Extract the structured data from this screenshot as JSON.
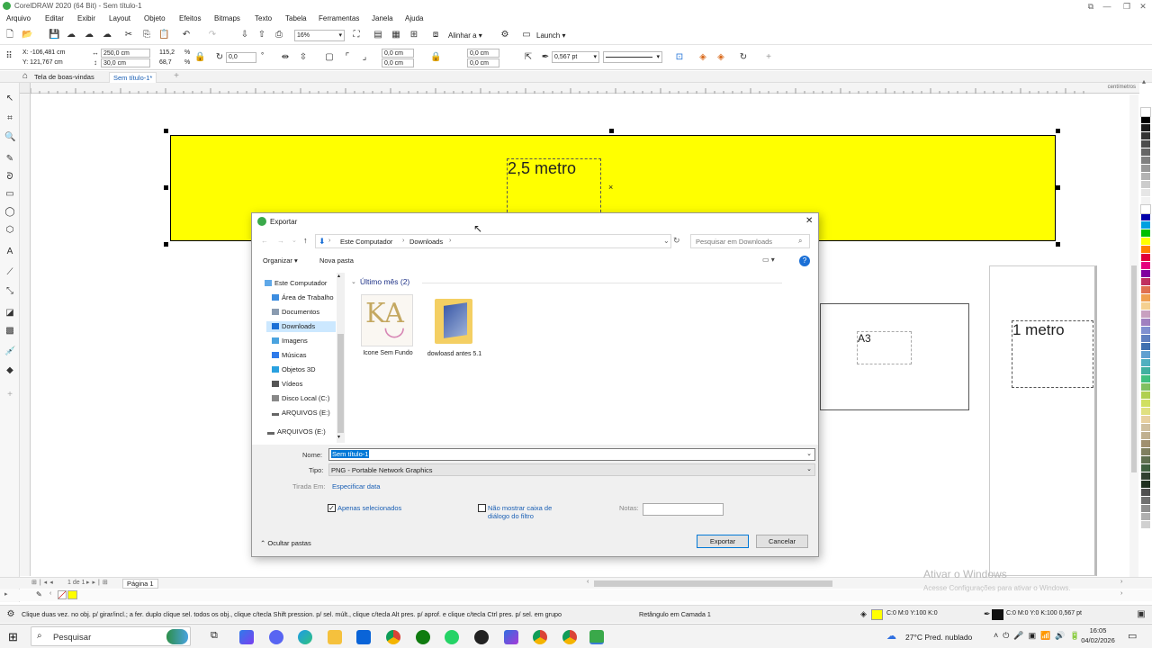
{
  "window": {
    "title": "CorelDRAW 2020 (64 Bit) - Sem título-1"
  },
  "menu": [
    "Arquivo",
    "Editar",
    "Exibir",
    "Layout",
    "Objeto",
    "Efeitos",
    "Bitmaps",
    "Texto",
    "Tabela",
    "Ferramentas",
    "Janela",
    "Ajuda"
  ],
  "toolbar": {
    "zoom": "16%",
    "align_label": "Alinhar a",
    "launch_label": "Launch"
  },
  "propbar": {
    "x": "X: -106,481 cm",
    "y": "Y: 121,767 cm",
    "w": "250,0 cm",
    "h": "30,0 cm",
    "sx": "115,2",
    "sy": "68,7",
    "pct": "%",
    "angle": "0,0",
    "deg": "°",
    "c1": "0,0 cm",
    "c2": "0,0 cm",
    "c3": "0,0 cm",
    "c4": "0,0 cm",
    "outline": "0,567 pt"
  },
  "tabs": {
    "welcome": "Tela de boas-vindas",
    "doc": "Sem título-1*"
  },
  "ruler_unit": "centímetros",
  "canvas": {
    "banner_text": "2,5 metro",
    "a3_text": "A3",
    "meter_text": "1 metro",
    "colors": {
      "yellow": "#ffff00"
    }
  },
  "pagenav": {
    "page_of": "1 de 1",
    "page_tab": "Página 1"
  },
  "statusbar": {
    "hint": "Clique duas vez. no obj. p/ girar/incl.; a fer. duplo clique sel. todos os obj., clique c/tecla Shift pression. p/ sel. múlt., clique c/tecla Alt pres. p/ aprof. e clique c/tecla Ctrl pres. p/ sel. em grupo",
    "selection": "Retângulo em Camada 1",
    "fill": "C:0 M:0 Y:100 K:0",
    "outline": "C:0 M:0 Y:0 K:100 0,567 pt"
  },
  "watermark": {
    "title": "Ativar o Windows",
    "sub": "Acesse Configurações para ativar o Windows."
  },
  "dialog": {
    "title": "Exportar",
    "breadcrumb": [
      "Este Computador",
      "Downloads"
    ],
    "search_placeholder": "Pesquisar em Downloads",
    "organize": "Organizar",
    "new_folder": "Nova pasta",
    "sidebar": [
      "Este Computador",
      "Área de Trabalho",
      "Documentos",
      "Downloads",
      "Imagens",
      "Músicas",
      "Objetos 3D",
      "Vídeos",
      "Disco Local (C:)",
      "ARQUIVOS (E:)",
      "ARQUIVOS (E:)"
    ],
    "group": "Último mês (2)",
    "files": [
      {
        "name": "Icone Sem Fundo"
      },
      {
        "name": "dowloasd antes 5.1"
      }
    ],
    "name_label": "Nome:",
    "name_value": "Sem título-1",
    "type_label": "Tipo:",
    "type_value": "PNG - Portable Network Graphics",
    "taken_label": "Tirada Em:",
    "taken_value": "Especificar data",
    "only_selected": "Apenas selecionados",
    "no_filter": "Não mostrar caixa de diálogo do filtro",
    "notes_label": "Notas:",
    "hide_folders": "Ocultar pastas",
    "export_btn": "Exportar",
    "cancel_btn": "Cancelar"
  },
  "taskbar": {
    "search": "Pesquisar",
    "weather": "27°C  Pred. nublado",
    "time": "16:05",
    "date": "04/02/2026"
  }
}
